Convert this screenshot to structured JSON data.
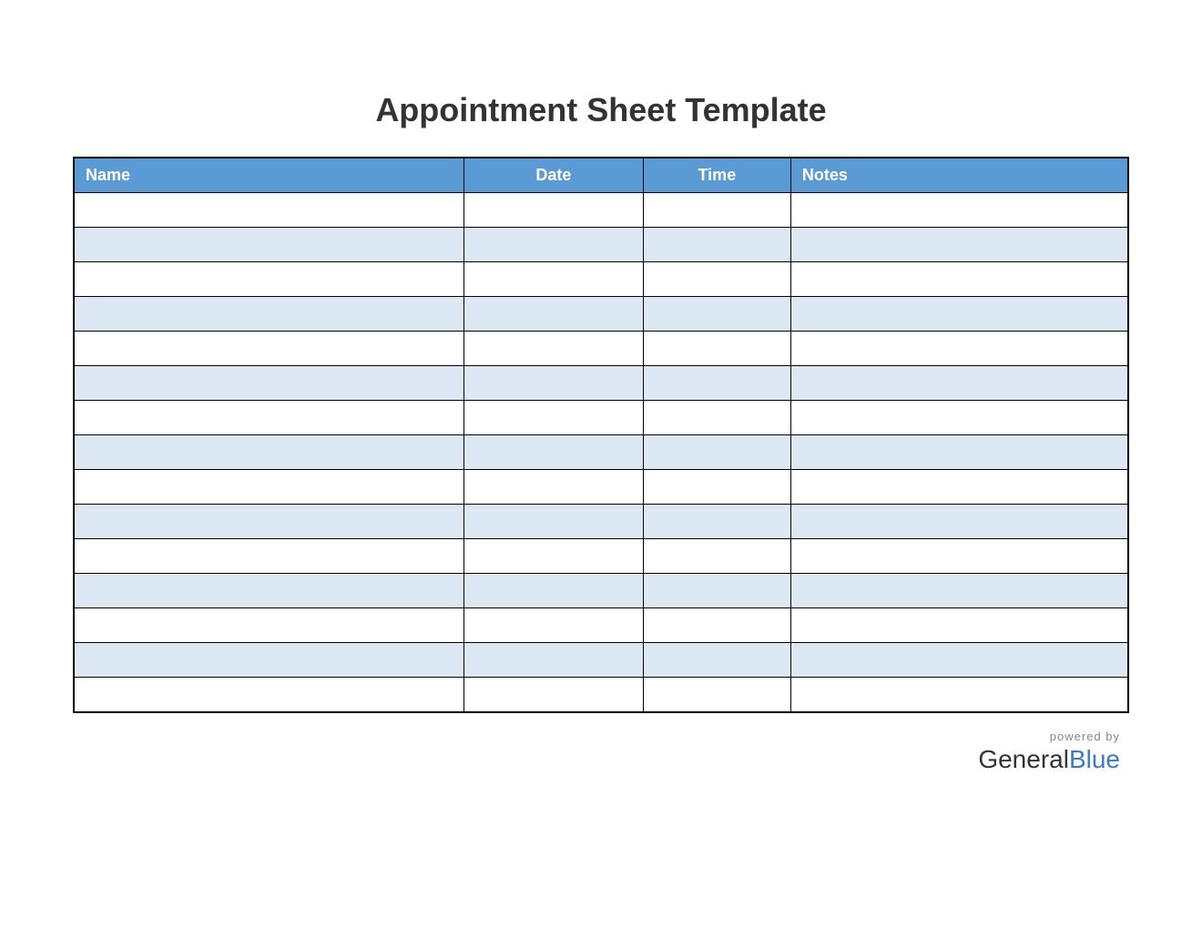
{
  "title": "Appointment Sheet Template",
  "columns": {
    "name": "Name",
    "date": "Date",
    "time": "Time",
    "notes": "Notes"
  },
  "rows": [
    {
      "name": "",
      "date": "",
      "time": "",
      "notes": ""
    },
    {
      "name": "",
      "date": "",
      "time": "",
      "notes": ""
    },
    {
      "name": "",
      "date": "",
      "time": "",
      "notes": ""
    },
    {
      "name": "",
      "date": "",
      "time": "",
      "notes": ""
    },
    {
      "name": "",
      "date": "",
      "time": "",
      "notes": ""
    },
    {
      "name": "",
      "date": "",
      "time": "",
      "notes": ""
    },
    {
      "name": "",
      "date": "",
      "time": "",
      "notes": ""
    },
    {
      "name": "",
      "date": "",
      "time": "",
      "notes": ""
    },
    {
      "name": "",
      "date": "",
      "time": "",
      "notes": ""
    },
    {
      "name": "",
      "date": "",
      "time": "",
      "notes": ""
    },
    {
      "name": "",
      "date": "",
      "time": "",
      "notes": ""
    },
    {
      "name": "",
      "date": "",
      "time": "",
      "notes": ""
    },
    {
      "name": "",
      "date": "",
      "time": "",
      "notes": ""
    },
    {
      "name": "",
      "date": "",
      "time": "",
      "notes": ""
    },
    {
      "name": "",
      "date": "",
      "time": "",
      "notes": ""
    }
  ],
  "footer": {
    "powered_by": "powered by",
    "logo_part1": "General",
    "logo_part2": "Blue"
  },
  "colors": {
    "header_bg": "#5b9bd5",
    "row_alt_bg": "#dce9f5",
    "logo_blue": "#3a7bc8"
  }
}
